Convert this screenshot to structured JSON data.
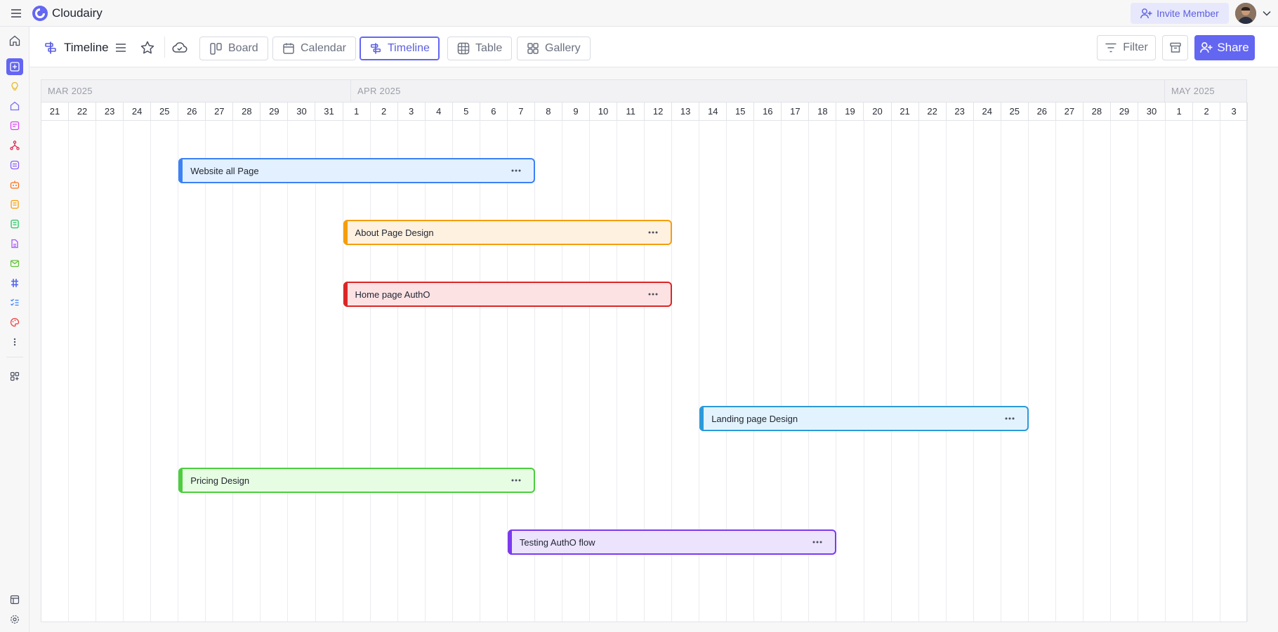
{
  "app": {
    "name": "Cloudairy",
    "invite_label": "Invite Member"
  },
  "toolbar": {
    "title": "Timeline",
    "views": [
      {
        "label": "Board",
        "icon": "board-icon"
      },
      {
        "label": "Calendar",
        "icon": "calendar-icon"
      },
      {
        "label": "Timeline",
        "icon": "timeline-icon",
        "active": true
      },
      {
        "label": "Table",
        "icon": "table-icon"
      },
      {
        "label": "Gallery",
        "icon": "gallery-icon"
      }
    ],
    "filter_label": "Filter",
    "share_label": "Share"
  },
  "timeline": {
    "months": [
      "MAR 2025",
      "APR 2025",
      "MAY 2025"
    ],
    "days": [
      "21",
      "22",
      "23",
      "24",
      "25",
      "26",
      "27",
      "28",
      "29",
      "30",
      "31",
      "1",
      "2",
      "3",
      "4",
      "5",
      "6",
      "7",
      "8",
      "9",
      "10",
      "11",
      "12",
      "13",
      "14",
      "15",
      "16",
      "17",
      "18",
      "19",
      "20",
      "21",
      "22",
      "23",
      "24",
      "25",
      "26",
      "27",
      "28",
      "29",
      "30",
      "1",
      "2",
      "3"
    ],
    "tasks": [
      {
        "label": "Website all Page",
        "start": "2025-03-26",
        "end": "2025-04-08",
        "fill": "#e3f0ff",
        "border": "#3b82f6"
      },
      {
        "label": "About Page Design",
        "start": "2025-04-01",
        "end": "2025-04-13",
        "fill": "#fff1e0",
        "border": "#f59e0b"
      },
      {
        "label": "Home page AuthO",
        "start": "2025-04-01",
        "end": "2025-04-13",
        "fill": "#fde2e4",
        "border": "#dc2626"
      },
      {
        "label": "Landing page Design",
        "start": "2025-04-14",
        "end": "2025-04-26",
        "fill": "#e2f3fd",
        "border": "#2b9ad9"
      },
      {
        "label": "Pricing Design",
        "start": "2025-03-26",
        "end": "2025-04-08",
        "fill": "#e7fde3",
        "border": "#4cce3f"
      },
      {
        "label": "Testing AuthO flow",
        "start": "2025-04-07",
        "end": "2025-04-19",
        "fill": "#ece3fd",
        "border": "#7c3aed"
      }
    ]
  },
  "colors": {
    "accent": "#6366f1"
  }
}
